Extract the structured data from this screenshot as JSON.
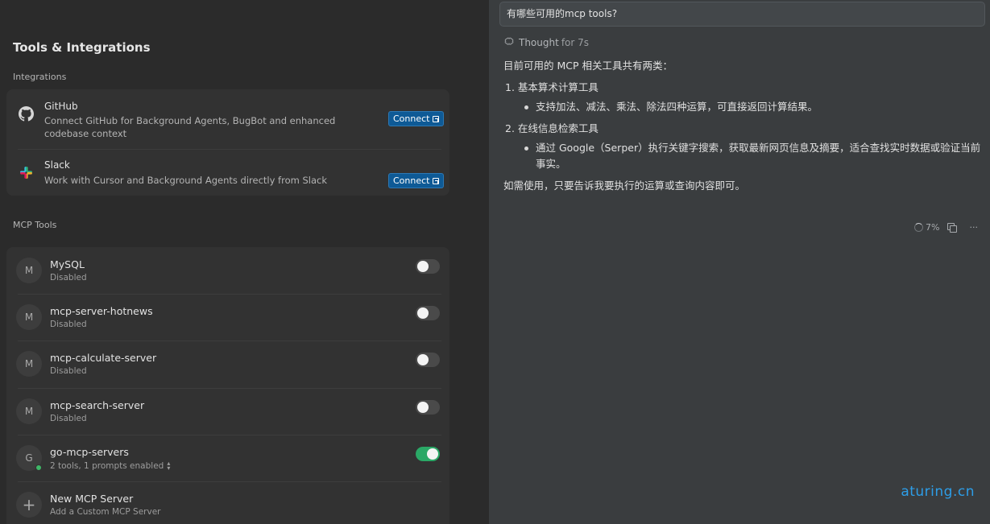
{
  "settings": {
    "title": "Tools & Integrations",
    "integrations_label": "Integrations",
    "integrations": [
      {
        "name": "GitHub",
        "icon": "github-icon",
        "description": "Connect GitHub for Background Agents, BugBot and enhanced codebase context",
        "action": "Connect"
      },
      {
        "name": "Slack",
        "icon": "slack-icon",
        "description": "Work with Cursor and Background Agents directly from Slack",
        "action": "Connect"
      }
    ],
    "mcp_label": "MCP Tools",
    "mcp_servers": [
      {
        "avatar": "M",
        "name": "MySQL",
        "status": "Disabled",
        "enabled": false
      },
      {
        "avatar": "M",
        "name": "mcp-server-hotnews",
        "status": "Disabled",
        "enabled": false
      },
      {
        "avatar": "M",
        "name": "mcp-calculate-server",
        "status": "Disabled",
        "enabled": false
      },
      {
        "avatar": "M",
        "name": "mcp-search-server",
        "status": "Disabled",
        "enabled": false
      },
      {
        "avatar": "G",
        "name": "go-mcp-servers",
        "status": "2 tools, 1 prompts enabled",
        "enabled": true
      }
    ],
    "new_server": {
      "name": "New MCP Server",
      "sub": "Add a Custom MCP Server"
    }
  },
  "chat": {
    "query": "有哪些可用的mcp tools?",
    "thought_label": "Thought",
    "thought_time": "for 7s",
    "intro": "目前可用的 MCP 相关工具共有两类：",
    "items": [
      {
        "title": "1. 基本算术计算工具",
        "bullet": "支持加法、减法、乘法、除法四种运算，可直接返回计算结果。"
      },
      {
        "title": "2. 在线信息检索工具",
        "bullet": "通过 Google（Serper）执行关键字搜索，获取最新网页信息及摘要，适合查找实时数据或验证当前事实。"
      }
    ],
    "outro": "如需使用，只要告诉我要执行的运算或查询内容即可。",
    "progress": "7%",
    "more": "···"
  },
  "watermark": "aturing.cn",
  "colors": {
    "connect_button": "#0e5a96",
    "toggle_on": "#2aa866",
    "online_dot": "#3fb868",
    "watermark": "#2d9ee8"
  }
}
